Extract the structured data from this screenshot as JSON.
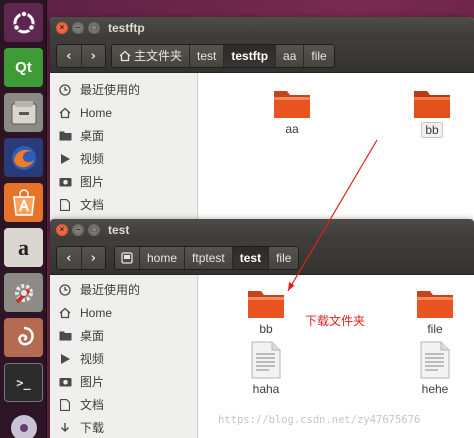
{
  "launcher": {
    "items": [
      {
        "name": "ubuntu-dash-icon"
      },
      {
        "name": "qt-creator-icon",
        "label": "Qt"
      },
      {
        "name": "files-icon"
      },
      {
        "name": "firefox-icon"
      },
      {
        "name": "software-center-icon"
      },
      {
        "name": "amazon-icon",
        "label": "a"
      },
      {
        "name": "system-settings-icon"
      },
      {
        "name": "debian-icon"
      },
      {
        "name": "terminal-icon",
        "label": ">_"
      },
      {
        "name": "dvd-icon"
      }
    ]
  },
  "window_back": {
    "title": "testftp",
    "breadcrumbs": [
      "主文件夹",
      "test",
      "testftp",
      "aa",
      "file"
    ],
    "active_crumb": "testftp",
    "sidebar": [
      "最近使用的",
      "Home",
      "桌面",
      "视频",
      "图片",
      "文档"
    ],
    "files": [
      {
        "name": "aa",
        "type": "folder",
        "selected": false
      },
      {
        "name": "bb",
        "type": "folder",
        "selected": true
      }
    ]
  },
  "window_front": {
    "title": "test",
    "breadcrumbs": [
      "home",
      "ftptest",
      "test",
      "file"
    ],
    "active_crumb": "test",
    "sidebar": [
      "最近使用的",
      "Home",
      "桌面",
      "视频",
      "图片",
      "文档",
      "下载"
    ],
    "files": [
      {
        "name": "bb",
        "type": "folder"
      },
      {
        "name": "file",
        "type": "folder"
      },
      {
        "name": "haha",
        "type": "text-file"
      },
      {
        "name": "hehe",
        "type": "text-file"
      }
    ]
  },
  "annotation": {
    "text": "下载文件夹",
    "color": "#e0201b"
  },
  "watermark": "https://blog.csdn.net/zy47675676",
  "colors": {
    "folder": "#e95420",
    "titlebar": "#3c3b37",
    "accent": "#e0201b"
  }
}
